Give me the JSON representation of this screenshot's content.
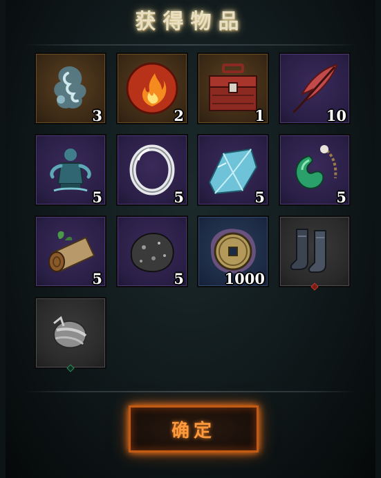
{
  "title": "获得物品",
  "confirm_label": "确定",
  "items": [
    {
      "icon": "ghost-wisp-icon",
      "rarity": "gold",
      "count": "3"
    },
    {
      "icon": "fire-orb-icon",
      "rarity": "gold",
      "count": "2"
    },
    {
      "icon": "treasure-chest-icon",
      "rarity": "gold",
      "count": "1"
    },
    {
      "icon": "red-feather-icon",
      "rarity": "purple",
      "count": "10"
    },
    {
      "icon": "spirit-statue-icon",
      "rarity": "purple",
      "count": "5"
    },
    {
      "icon": "silver-ring-icon",
      "rarity": "purple",
      "count": "5"
    },
    {
      "icon": "ice-crystal-icon",
      "rarity": "purple",
      "count": "5"
    },
    {
      "icon": "jade-pendant-icon",
      "rarity": "purple",
      "count": "5"
    },
    {
      "icon": "wood-log-icon",
      "rarity": "purple",
      "count": "5"
    },
    {
      "icon": "ore-stone-icon",
      "rarity": "purple",
      "count": "5"
    },
    {
      "icon": "copper-coin-icon",
      "rarity": "blue",
      "count": "1000"
    },
    {
      "icon": "boots-icon",
      "rarity": "gray",
      "count": ""
    },
    {
      "icon": "bandage-wrap-icon",
      "rarity": "gray",
      "count": ""
    }
  ],
  "colors": {
    "gold_frame": "#6a4b22",
    "purple_frame": "#4a3774",
    "blue_frame": "#34476e",
    "gray_frame": "#4d4d4d",
    "button_glow": "#ff7a1a"
  }
}
